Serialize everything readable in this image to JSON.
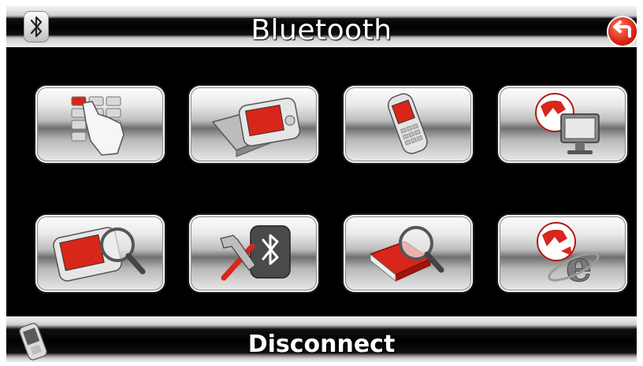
{
  "header": {
    "title": "Bluetooth",
    "bluetooth_icon": "bluetooth-icon",
    "back_icon": "back-arrow-icon"
  },
  "grid": {
    "items": [
      {
        "icon": "dial-keypad-icon"
      },
      {
        "icon": "pda-device-icon"
      },
      {
        "icon": "mobile-phone-icon"
      },
      {
        "icon": "globe-monitor-icon"
      },
      {
        "icon": "device-search-icon"
      },
      {
        "icon": "bluetooth-settings-icon"
      },
      {
        "icon": "phonebook-search-icon"
      },
      {
        "icon": "internet-explorer-globe-icon"
      }
    ]
  },
  "footer": {
    "label": "Disconnect",
    "icon": "phone-device-icon"
  },
  "colors": {
    "accent_red": "#d8261a",
    "background": "#000000",
    "text": "#ffffff"
  }
}
